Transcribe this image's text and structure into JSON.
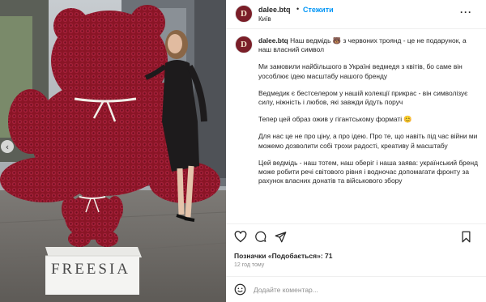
{
  "post": {
    "username": "dalee.btq",
    "separator": "•",
    "follow_label": "Стежити",
    "location": "Київ",
    "more_label": "···",
    "avatar_monogram": "D",
    "photo_box_text": "FREESIA",
    "photo_nav_arrow": "‹"
  },
  "caption": {
    "username": "dalee.btq",
    "first_line": "Наш ведмідь 🐻 з червоних троянд - це не подарунок, а наш власний символ",
    "paragraphs": [
      "Ми замовили найбільшого в Україні ведмедя з квітів, бо саме він уособлює ідею масштабу нашого бренду",
      "Ведмедик є бестселером у нашій колекції прикрас - він символізує силу, ніжність і любов, які завжди йдуть поруч",
      "Тепер цей образ ожив у гігантському форматі 😊",
      "Для нас це не про ціну, а про ідею. Про те, що навіть під час війни ми можемо дозволити собі трохи радості, креативу й масштабу",
      "Цей ведмідь - наш тотем, наш оберіг і наша заява: український бренд може робити речі світового рівня і водночас допомагати фронту за рахунок власних донатів та військового збору"
    ]
  },
  "stats": {
    "likes_text": "Позначки «Подобається»: 71",
    "time_text": "12 год тому"
  },
  "comment": {
    "placeholder": "Додайте коментар..."
  },
  "icons": {
    "like": "heart-icon",
    "comment": "comment-icon",
    "share": "send-icon",
    "save": "bookmark-icon",
    "emoji": "emoji-icon",
    "more": "more-icon"
  },
  "colors": {
    "accent": "#0095f6",
    "brand_avatar": "#7a1e28",
    "roses": "#8e1628",
    "muted_text": "#8e8e8e"
  }
}
